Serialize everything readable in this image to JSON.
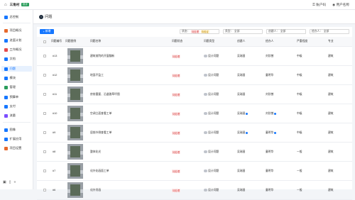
{
  "topbar": {
    "project": "三角村",
    "badge": "设计",
    "account_label": "账户码",
    "user_label": "用户名称"
  },
  "sidebar": {
    "items": [
      {
        "label": "总控制",
        "icon": "dashboard-icon",
        "color": "#1677ff"
      },
      {
        "label": "项目概况",
        "icon": "overview-icon",
        "color": "#e6692d"
      },
      {
        "label": "进度计划",
        "icon": "schedule-icon",
        "color": "#1677ff"
      },
      {
        "label": "工作概况",
        "icon": "work-icon",
        "color": "#e54b4b"
      },
      {
        "label": "文档",
        "icon": "document-icon",
        "color": "#1677ff"
      },
      {
        "label": "问题",
        "icon": "issue-icon",
        "color": "#1677ff",
        "active": true
      },
      {
        "label": "模块",
        "icon": "module-icon",
        "color": "#1677ff"
      },
      {
        "label": "管理",
        "icon": "manage-icon",
        "color": "#2a9d5c"
      },
      {
        "label": "预算单",
        "icon": "budget-icon",
        "color": "#1677ff"
      },
      {
        "label": "支付",
        "icon": "payment-icon",
        "color": "#1677ff"
      },
      {
        "label": "流量",
        "icon": "flow-icon",
        "color": "#7c4dff"
      },
      {
        "label": "图像",
        "icon": "image-icon",
        "color": "#1677ff"
      },
      {
        "label": "扩展应用",
        "icon": "apps-icon",
        "color": "#1677ff"
      },
      {
        "label": "项目设置",
        "icon": "settings-icon",
        "color": "#e6692d"
      }
    ]
  },
  "page": {
    "title": "问题",
    "new_button": "新增"
  },
  "filters": {
    "status_label": "状态：",
    "status_tags": [
      "待处理",
      "待验证"
    ],
    "type_label": "类型：",
    "type_value": "全部",
    "creator_label": "创建人：",
    "creator_value": "全部",
    "assignee_label": "经办人：",
    "assignee_value": "全部"
  },
  "table": {
    "headers": [
      "问题编号",
      "问题图例",
      "问题名称",
      "问题状态",
      "问题类型",
      "创建人",
      "经办人",
      "严重程度",
      "专业"
    ],
    "rows": [
      {
        "id": "#13",
        "name": "建筑前院的开窗翻新",
        "status": "待处理",
        "type": "设计问题",
        "creator": "吴瑞昌",
        "assignee": "刘欣曾",
        "severity": "中级",
        "discipline": "建筑"
      },
      {
        "id": "#12",
        "name": "地面不监工",
        "status": "待处理",
        "type": "设计问题",
        "creator": "吴瑞昌",
        "assignee": "童明华",
        "severity": "中级",
        "discipline": "建筑"
      },
      {
        "id": "#11",
        "name": "房前重要、沿道路草坪图",
        "status": "待处理",
        "type": "设计问题",
        "creator": "吴瑞昌",
        "assignee": "刘欣曾",
        "severity": "中级",
        "discipline": "建筑"
      },
      {
        "id": "#10",
        "name": "空调立面查看工单",
        "status": "待处理",
        "type": "设计问题",
        "creator": "吴瑞昌",
        "assignee": "刘欣曾",
        "severity": "中级",
        "discipline": "建筑"
      },
      {
        "id": "#9",
        "name": "居前外侧查看工单",
        "status": "待处理",
        "type": "设计问题",
        "creator": "吴瑞昌",
        "assignee": "童明华",
        "severity": "中级",
        "discipline": "建筑"
      },
      {
        "id": "#8",
        "name": "整体化光",
        "status": "待处理",
        "type": "设计问题",
        "creator": "吴瑞昌",
        "assignee": "童明华",
        "severity": "一般",
        "discipline": "建筑"
      },
      {
        "id": "#7",
        "name": "化外化画面工单",
        "status": "待处理",
        "type": "设计问题",
        "creator": "吴瑞昌",
        "assignee": "童明华",
        "severity": "一般",
        "discipline": "建筑"
      },
      {
        "id": "#6",
        "name": "化外吊画",
        "status": "待处理",
        "type": "设计问题",
        "creator": "吴瑞昌",
        "assignee": "童明华",
        "severity": "一般",
        "discipline": "建筑"
      }
    ]
  }
}
